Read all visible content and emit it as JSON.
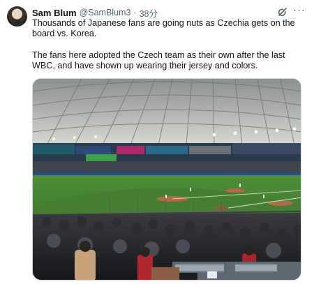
{
  "tweet": {
    "author_name": "Sam Blum",
    "author_handle": "@SamBlum3",
    "separator": "·",
    "timestamp": "38分",
    "text_paragraphs": [
      "Thousands of Japanese fans are going nuts as Czechia gets on the board vs. Korea.",
      "The fans here adopted the Czech team as their own after the last WBC, and have shown up wearing their jersey and colors."
    ],
    "icons": {
      "grok": "grok-icon",
      "more": "more-options-icon",
      "more_glyph": "···"
    },
    "media_description_kind": "photo"
  },
  "colors": {
    "text_primary": "#0f1419",
    "text_secondary": "#536471",
    "border": "#cfd9de"
  }
}
